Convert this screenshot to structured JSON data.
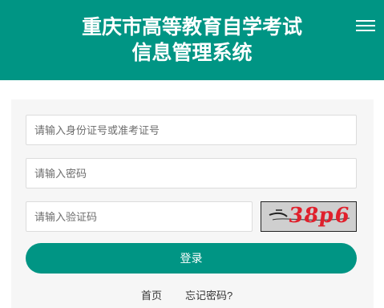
{
  "header": {
    "title_line1": "重庆市高等教育自学考试",
    "title_line2": "信息管理系统",
    "menu_icon": "hamburger-menu-icon"
  },
  "form": {
    "id_placeholder": "请输入身份证号或准考证号",
    "password_placeholder": "请输入密码",
    "captcha_placeholder": "请输入验证码",
    "captcha_text": "38p6",
    "login_label": "登录"
  },
  "links": {
    "home": "首页",
    "forgot_password": "忘记密码?"
  },
  "colors": {
    "brand": "#009584",
    "captcha_text": "#e0202c"
  }
}
